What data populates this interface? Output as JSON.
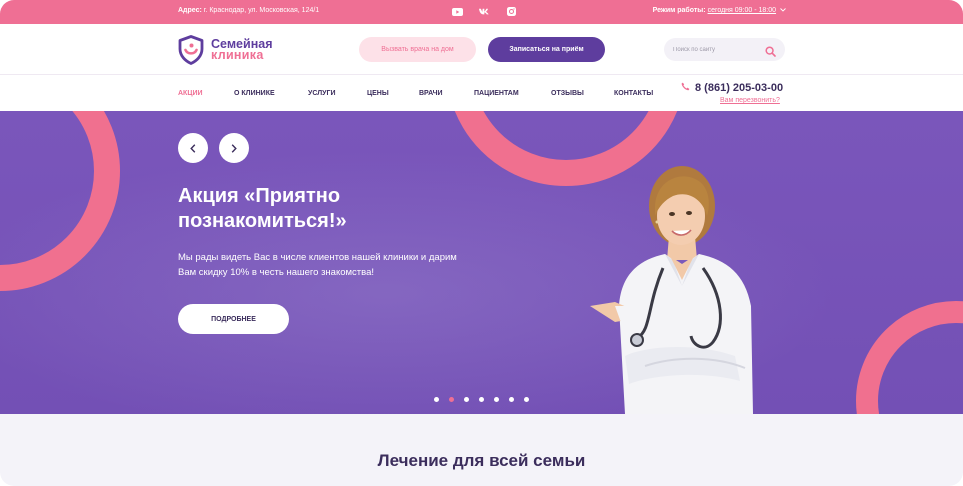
{
  "topbar": {
    "address_label": "Адрес:",
    "address_value": "г. Краснодар, ул. Московская, 124/1",
    "socials": [
      "youtube-icon",
      "vk-icon",
      "instagram-icon"
    ],
    "hours_label": "Режим работы:",
    "hours_value": "сегодня 09:00 - 18:00"
  },
  "header": {
    "logo_line1": "Семейная",
    "logo_line2": "клиника",
    "call_button": "Вызвать врача на дом",
    "signup_button": "Записаться на приём",
    "search_placeholder": "Поиск по сайту"
  },
  "nav": {
    "items": [
      "АКЦИИ",
      "О КЛИНИКЕ",
      "УСЛУГИ",
      "ЦЕНЫ",
      "ВРАЧИ",
      "ПАЦИЕНТАМ",
      "ОТЗЫВЫ",
      "КОНТАКТЫ"
    ],
    "active_index": 0,
    "phone": "8 (861) 205-03-00",
    "callback": "Вам перезвонить?"
  },
  "hero": {
    "title_line1": "Акция «Приятно",
    "title_line2": "познакомиться!»",
    "text_line1": "Мы рады видеть Вас в числе клиентов нашей клиники и дарим",
    "text_line2": "Вам скидку 10% в честь нашего знакомства!",
    "button": "ПОДРОБНЕЕ",
    "slides_total": 7,
    "active_slide": 2
  },
  "section": {
    "title": "Лечение для всей семьи"
  },
  "colors": {
    "pink": "#ef6f94",
    "purple": "#5e3d9e",
    "hero_bg": "#7752b8",
    "dark_text": "#3b2d5c"
  }
}
